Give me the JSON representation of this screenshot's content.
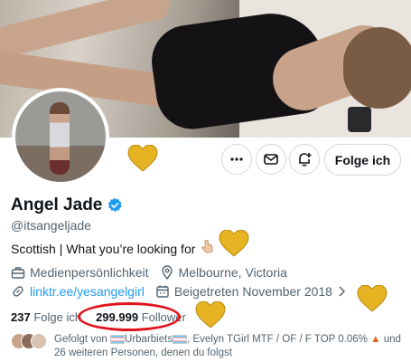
{
  "profile": {
    "name": "Angel Jade",
    "handle": "@itsangeljade",
    "bio": "Scottish | What you’re looking for",
    "category": "Medienpersönlichkeit",
    "location": "Melbourne, Victoria",
    "link": "linktr.ee/yesangelgirl",
    "joined": "Beigetreten November 2018",
    "verified_icon": "verified-badge-icon",
    "accent_color": "#1d9bf0"
  },
  "actions": {
    "more_icon": "more-icon",
    "message_icon": "mail-icon",
    "notify_icon": "bell-plus-icon",
    "follow_label": "Folge ich"
  },
  "stats": {
    "following_count": "237",
    "following_label": "Folge ich",
    "followers_count": "299.999",
    "followers_label": "Follower",
    "highlight_color": "#e0141c"
  },
  "followed_by": {
    "prefix": "Gefolgt von",
    "name1": "Urbarbiets",
    "name2": ", Evelyn TGirl MTF / OF / F TOP 0.06%",
    "suffix": "und 26 weiteren Personen, denen du folgst"
  }
}
